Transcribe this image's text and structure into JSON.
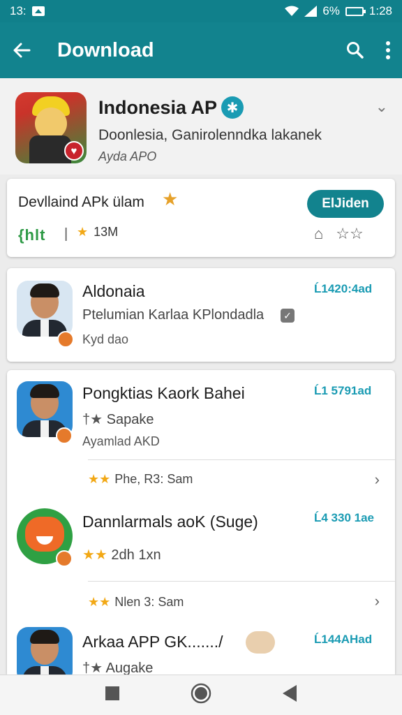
{
  "status": {
    "time": "13:",
    "battery_text": "6%",
    "clock_right": "1:28"
  },
  "appbar": {
    "title": "Download",
    "back_icon": "arrow-left-icon",
    "search_icon": "search-icon",
    "menu_icon": "more-vert-icon"
  },
  "header": {
    "title": "Indonesia AP",
    "subtitle": "Doonlesia, Ganirolenndka lakanek",
    "developer": "Ayda APO"
  },
  "download_card": {
    "title": "Devllaind APk ülam",
    "tag": "{hlt",
    "separator": "|",
    "rating": "13M",
    "button": "ElJiden"
  },
  "items": [
    {
      "title": "Aldonaia",
      "subtitle": "Ptelumian Karlaa  KPlondadla",
      "meta": "Kyd dao",
      "count": "Ĺ1420:4ad"
    },
    {
      "title": "Pongktias Kaork Bahei",
      "subtitle": "Sapake",
      "meta": "Ayamlad AKD",
      "count": "Ĺ1 5791ad",
      "rating": "Phe, R3: Sam"
    },
    {
      "title": "Dannlarmals aoK (Suge)",
      "subtitle": "2dh 1xn",
      "count": "Ĺ4 330 1ae",
      "rating": "Nlen 3: Sam"
    },
    {
      "title": "Arkaa APP  GK......./",
      "subtitle": "Augake",
      "count": "Ĺ144AHad"
    }
  ],
  "colors": {
    "primary": "#12838e",
    "accent": "#1a9bb3",
    "star": "#f2a815",
    "green_tag": "#2e9a46"
  }
}
